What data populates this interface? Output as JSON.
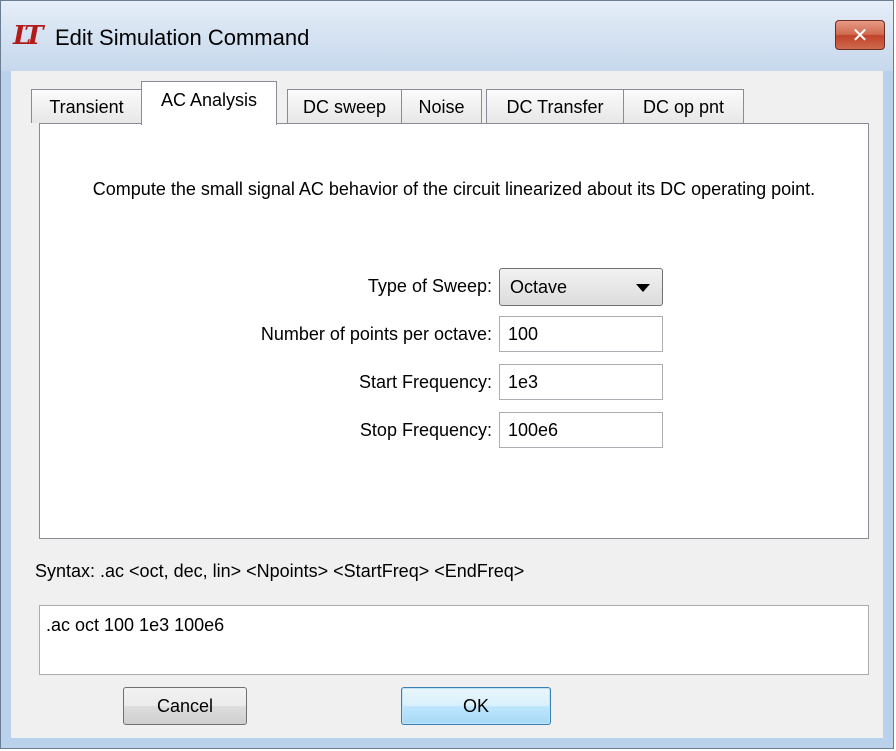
{
  "window": {
    "title": "Edit Simulation Command",
    "logo_text": "LT",
    "close_label": "✕"
  },
  "tabs": [
    {
      "label": "Transient",
      "active": false
    },
    {
      "label": "AC Analysis",
      "active": true
    },
    {
      "label": "DC sweep",
      "active": false
    },
    {
      "label": "Noise",
      "active": false
    },
    {
      "label": "DC Transfer",
      "active": false
    },
    {
      "label": "DC op pnt",
      "active": false
    }
  ],
  "panel": {
    "description": "Compute the small signal AC behavior of the circuit linearized about its DC operating point.",
    "sweep_type": {
      "label": "Type of Sweep:",
      "value": "Octave"
    },
    "points": {
      "label": "Number of points per octave:",
      "value": "100"
    },
    "start_freq": {
      "label": "Start Frequency:",
      "value": "1e3"
    },
    "stop_freq": {
      "label": "Stop Frequency:",
      "value": "100e6"
    }
  },
  "syntax": "Syntax:  .ac <oct, dec, lin> <Npoints> <StartFreq> <EndFreq>",
  "command": ".ac oct 100 1e3 100e6",
  "buttons": {
    "cancel": "Cancel",
    "ok": "OK"
  },
  "colors": {
    "logo": "#b31b1b",
    "close": "#c0432a",
    "titlebar": "#d6e3f2"
  }
}
